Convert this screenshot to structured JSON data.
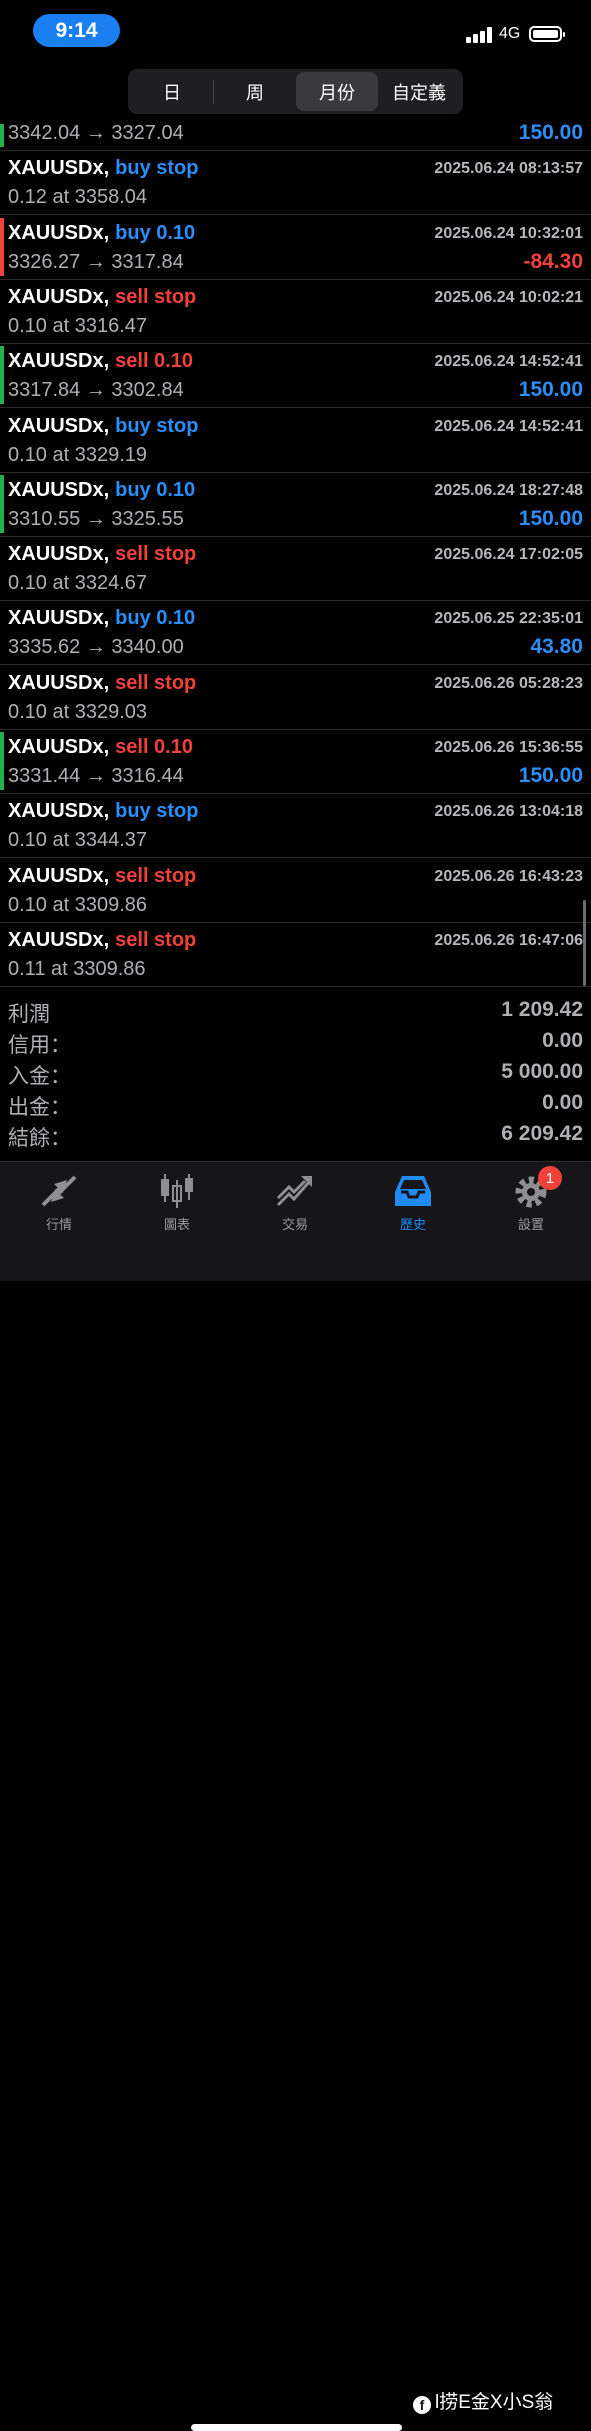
{
  "status_bar": {
    "time": "9:14",
    "network": "4G"
  },
  "segments": [
    {
      "label": "日",
      "active": false
    },
    {
      "label": "周",
      "active": false
    },
    {
      "label": "月份",
      "active": true
    },
    {
      "label": "自定義",
      "active": false
    }
  ],
  "orders": [
    {
      "symbol": "",
      "action": "",
      "action_color": "",
      "timestamp": "",
      "detail": "3342.04 → 3327.04",
      "profit": "150.00",
      "profit_color": "#2c8ef8",
      "bar_color": "#22b14c"
    },
    {
      "symbol": "XAUUSDx,",
      "action": "buy stop",
      "action_color": "#2c8ef8",
      "timestamp": "2025.06.24 08:13:57",
      "detail": "0.12 at 3358.04",
      "profit": "",
      "profit_color": "",
      "bar_color": ""
    },
    {
      "symbol": "XAUUSDx,",
      "action": "buy 0.10",
      "action_color": "#2c8ef8",
      "timestamp": "2025.06.24 10:32:01",
      "detail": "3326.27 → 3317.84",
      "profit": "-84.30",
      "profit_color": "#f0413c",
      "bar_color": "#f0413c"
    },
    {
      "symbol": "XAUUSDx,",
      "action": "sell stop",
      "action_color": "#f0413c",
      "timestamp": "2025.06.24 10:02:21",
      "detail": "0.10 at 3316.47",
      "profit": "",
      "profit_color": "",
      "bar_color": ""
    },
    {
      "symbol": "XAUUSDx,",
      "action": "sell 0.10",
      "action_color": "#f0413c",
      "timestamp": "2025.06.24 14:52:41",
      "detail": "3317.84 → 3302.84",
      "profit": "150.00",
      "profit_color": "#2c8ef8",
      "bar_color": "#22b14c"
    },
    {
      "symbol": "XAUUSDx,",
      "action": "buy stop",
      "action_color": "#2c8ef8",
      "timestamp": "2025.06.24 14:52:41",
      "detail": "0.10 at 3329.19",
      "profit": "",
      "profit_color": "",
      "bar_color": ""
    },
    {
      "symbol": "XAUUSDx,",
      "action": "buy 0.10",
      "action_color": "#2c8ef8",
      "timestamp": "2025.06.24 18:27:48",
      "detail": "3310.55 → 3325.55",
      "profit": "150.00",
      "profit_color": "#2c8ef8",
      "bar_color": "#22b14c"
    },
    {
      "symbol": "XAUUSDx,",
      "action": "sell stop",
      "action_color": "#f0413c",
      "timestamp": "2025.06.24 17:02:05",
      "detail": "0.10 at 3324.67",
      "profit": "",
      "profit_color": "",
      "bar_color": ""
    },
    {
      "symbol": "XAUUSDx,",
      "action": "buy 0.10",
      "action_color": "#2c8ef8",
      "timestamp": "2025.06.25 22:35:01",
      "detail": "3335.62 → 3340.00",
      "profit": "43.80",
      "profit_color": "#2c8ef8",
      "bar_color": ""
    },
    {
      "symbol": "XAUUSDx,",
      "action": "sell stop",
      "action_color": "#f0413c",
      "timestamp": "2025.06.26 05:28:23",
      "detail": "0.10 at 3329.03",
      "profit": "",
      "profit_color": "",
      "bar_color": ""
    },
    {
      "symbol": "XAUUSDx,",
      "action": "sell 0.10",
      "action_color": "#f0413c",
      "timestamp": "2025.06.26 15:36:55",
      "detail": "3331.44 → 3316.44",
      "profit": "150.00",
      "profit_color": "#2c8ef8",
      "bar_color": "#22b14c"
    },
    {
      "symbol": "XAUUSDx,",
      "action": "buy stop",
      "action_color": "#2c8ef8",
      "timestamp": "2025.06.26 13:04:18",
      "detail": "0.10 at 3344.37",
      "profit": "",
      "profit_color": "",
      "bar_color": ""
    },
    {
      "symbol": "XAUUSDx,",
      "action": "sell stop",
      "action_color": "#f0413c",
      "timestamp": "2025.06.26 16:43:23",
      "detail": "0.10 at 3309.86",
      "profit": "",
      "profit_color": "",
      "bar_color": ""
    },
    {
      "symbol": "XAUUSDx,",
      "action": "sell stop",
      "action_color": "#f0413c",
      "timestamp": "2025.06.26 16:47:06",
      "detail": "0.11 at 3309.86",
      "profit": "",
      "profit_color": "",
      "bar_color": ""
    }
  ],
  "summary": [
    {
      "label": "利潤",
      "value": "1 209.42"
    },
    {
      "label": "信用：",
      "value": "0.00"
    },
    {
      "label": "入金：",
      "value": "5 000.00"
    },
    {
      "label": "出金：",
      "value": "0.00"
    },
    {
      "label": "結餘：",
      "value": "6 209.42"
    }
  ],
  "tabs": [
    {
      "label": "行情",
      "icon": "quotes-arrows-icon",
      "active": false
    },
    {
      "label": "圖表",
      "icon": "candlestick-chart-icon",
      "active": false
    },
    {
      "label": "交易",
      "icon": "trade-trend-icon",
      "active": false
    },
    {
      "label": "歷史",
      "icon": "history-inbox-icon",
      "active": true
    },
    {
      "label": "設置",
      "icon": "gear-icon",
      "active": false,
      "badge": "1"
    }
  ],
  "watermark": "l捞E金X小S翁",
  "colors": {
    "accent": "#1f8bf5",
    "buy": "#2c8ef8",
    "sell": "#f0413c",
    "profit_bar": "#22b14c"
  }
}
